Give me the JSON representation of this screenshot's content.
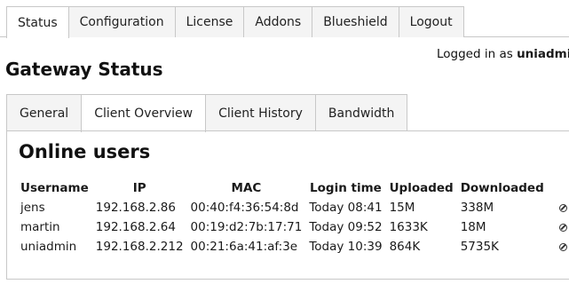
{
  "nav": {
    "tabs": [
      {
        "label": "Status",
        "active": true
      },
      {
        "label": "Configuration",
        "active": false
      },
      {
        "label": "License",
        "active": false
      },
      {
        "label": "Addons",
        "active": false
      },
      {
        "label": "Blueshield",
        "active": false
      },
      {
        "label": "Logout",
        "active": false
      }
    ]
  },
  "header": {
    "login_prefix": "Logged in as",
    "username": "uniadmin",
    "title": "Gateway Status"
  },
  "subnav": {
    "tabs": [
      {
        "label": "General",
        "active": false
      },
      {
        "label": "Client Overview",
        "active": true
      },
      {
        "label": "Client History",
        "active": false
      },
      {
        "label": "Bandwidth",
        "active": false
      }
    ]
  },
  "online_users": {
    "title": "Online users",
    "columns": [
      "Username",
      "IP",
      "MAC",
      "Login time",
      "Uploaded",
      "Downloaded"
    ],
    "rows": [
      {
        "username": "jens",
        "ip": "192.168.2.86",
        "mac": "00:40:f4:36:54:8d",
        "login_time": "Today 08:41",
        "uploaded": "15M",
        "downloaded": "338M"
      },
      {
        "username": "martin",
        "ip": "192.168.2.64",
        "mac": "00:19:d2:7b:17:71",
        "login_time": "Today 09:52",
        "uploaded": "1633K",
        "downloaded": "18M"
      },
      {
        "username": "uniadmin",
        "ip": "192.168.2.212",
        "mac": "00:21:6a:41:af:3e",
        "login_time": "Today 10:39",
        "uploaded": "864K",
        "downloaded": "5735K"
      }
    ],
    "row_action_icons": [
      "block-icon",
      "remove-icon"
    ]
  }
}
